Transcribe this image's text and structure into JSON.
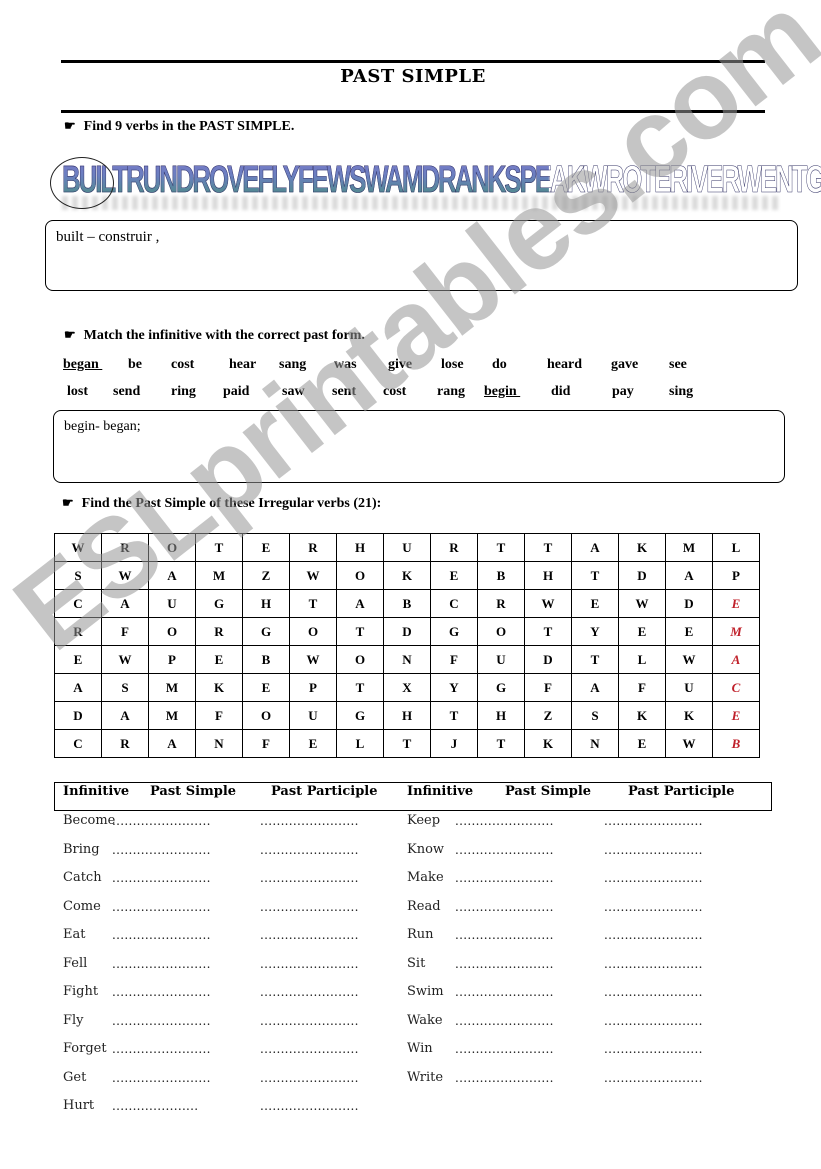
{
  "title": "PAST SIMPLE",
  "section1": {
    "instruction": "Find 9 verbs in the PAST SIMPLE.",
    "wordart": "BUILTRUNDROVEFLYFEWSWAMDRANKSPEAKWROTERIVERWENTGOMADECUTMET",
    "answer_example": "built – construir ,"
  },
  "section2": {
    "instruction": "Match the infinitive with the correct past form.",
    "row1": [
      "began",
      "be",
      "cost",
      "hear",
      "sang",
      "was",
      "give",
      "lose",
      "do",
      "heard",
      "gave",
      "see"
    ],
    "row2": [
      "lost",
      "send",
      "ring",
      "paid",
      "saw",
      "sent",
      "cost",
      "rang",
      "begin",
      "did",
      "pay",
      "sing"
    ],
    "underlined": [
      "began",
      "begin"
    ],
    "answer_example": "begin- began;"
  },
  "section3": {
    "instruction": "Find the Past Simple of these Irregular verbs (21):",
    "grid": [
      [
        "W",
        "R",
        "O",
        "T",
        "E",
        "R",
        "H",
        "U",
        "R",
        "T",
        "T",
        "A",
        "K",
        "M",
        "L"
      ],
      [
        "S",
        "W",
        "A",
        "M",
        "Z",
        "W",
        "O",
        "K",
        "E",
        "B",
        "H",
        "T",
        "D",
        "A",
        "P"
      ],
      [
        "C",
        "A",
        "U",
        "G",
        "H",
        "T",
        "A",
        "B",
        "C",
        "R",
        "W",
        "E",
        "W",
        "D",
        "E"
      ],
      [
        "R",
        "F",
        "O",
        "R",
        "G",
        "O",
        "T",
        "D",
        "G",
        "O",
        "T",
        "Y",
        "E",
        "E",
        "M"
      ],
      [
        "E",
        "W",
        "P",
        "E",
        "B",
        "W",
        "O",
        "N",
        "F",
        "U",
        "D",
        "T",
        "L",
        "W",
        "A"
      ],
      [
        "A",
        "S",
        "M",
        "K",
        "E",
        "P",
        "T",
        "X",
        "Y",
        "G",
        "F",
        "A",
        "F",
        "U",
        "C"
      ],
      [
        "D",
        "A",
        "M",
        "F",
        "O",
        "U",
        "G",
        "H",
        "T",
        "H",
        "Z",
        "S",
        "K",
        "K",
        "E"
      ],
      [
        "C",
        "R",
        "A",
        "N",
        "F",
        "E",
        "L",
        "T",
        "J",
        "T",
        "K",
        "N",
        "E",
        "W",
        "B"
      ]
    ],
    "highlighted_column_color": "#c0202a"
  },
  "table": {
    "headers": [
      "Infinitive",
      "Past Simple",
      "Past Participle",
      "Infinitive",
      "Past Simple",
      "Past Participle"
    ],
    "left_verbs": [
      "Become",
      "Bring",
      "Catch",
      "Come",
      "Eat",
      "Fell",
      "Fight",
      "Fly",
      "Forget",
      "Get",
      "Hurt"
    ],
    "right_verbs": [
      "Keep",
      "Know",
      "Make",
      "Read",
      "Run",
      "Sit",
      "Swim",
      "Wake",
      "Win",
      "Write"
    ],
    "blank": "........................"
  },
  "watermark": "ESLprintables.com",
  "icons": {
    "bullet": "pointing-hand-icon"
  }
}
